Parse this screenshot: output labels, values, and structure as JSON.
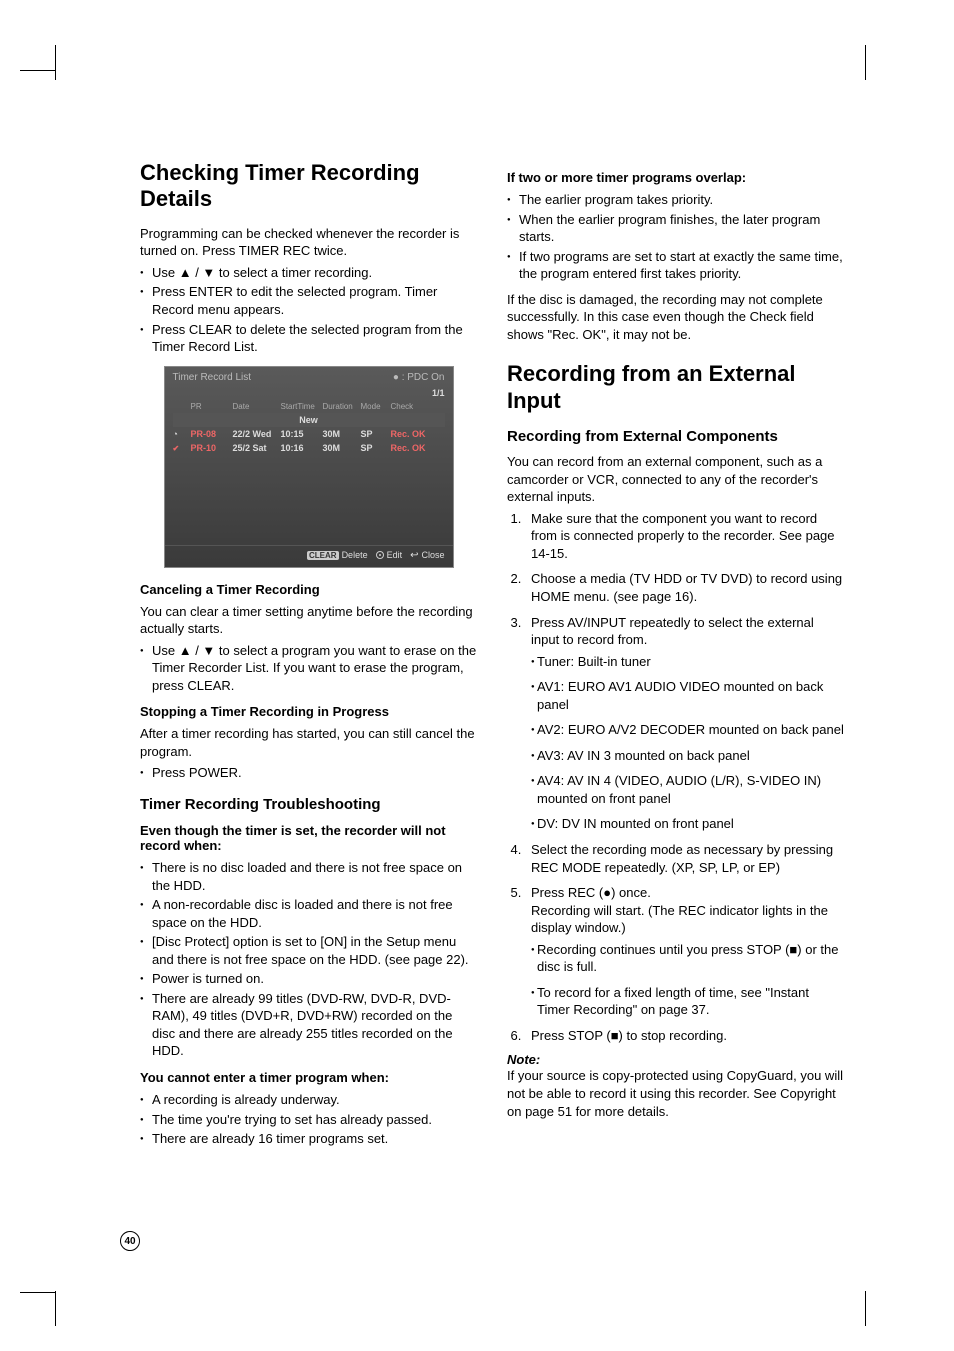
{
  "page_number": "40",
  "left": {
    "h1": "Checking Timer Recording Details",
    "intro": "Programming can be checked whenever the recorder is turned on. Press TIMER REC twice.",
    "intro_list": [
      "Use ▲ / ▼ to select a timer recording.",
      "Press ENTER to edit the selected program. Timer Record menu appears.",
      "Press CLEAR to delete the selected program from the Timer Record List."
    ],
    "h3_cancel": "Canceling a Timer Recording",
    "cancel_p": "You can clear a timer setting anytime before the recording actually starts.",
    "cancel_list": [
      "Use ▲ / ▼ to select a program you want to erase on the Timer Recorder List. If you want to erase the program, press CLEAR."
    ],
    "h3_stop": "Stopping a Timer Recording in Progress",
    "stop_p": "After a timer recording has started, you can still cancel the program.",
    "stop_list": [
      "Press POWER."
    ],
    "h2_trouble": "Timer Recording Troubleshooting",
    "trouble_sub1": "Even though the timer is set, the recorder will not record when:",
    "trouble_list1": [
      "There is no disc loaded and there is not free space on the HDD.",
      "A non-recordable disc is loaded and there is not free space on the HDD.",
      "[Disc Protect] option is set to [ON] in the Setup menu and there is not free space on the HDD. (see page 22).",
      "Power is turned on.",
      "There are already 99 titles (DVD-RW, DVD-R, DVD-RAM), 49 titles (DVD+R, DVD+RW) recorded on the disc and there are already 255 titles recorded on the HDD."
    ],
    "trouble_sub2": "You cannot enter a timer program when:",
    "trouble_list2": [
      "A recording is already underway.",
      "The time you're trying to set has already passed.",
      "There are already 16 timer programs set."
    ]
  },
  "right": {
    "overlap_h3": "If two or more timer programs overlap:",
    "overlap_list": [
      "The earlier program takes priority.",
      "When the earlier program finishes, the later program starts.",
      "If two programs are set to start at exactly the same time, the program entered first takes priority."
    ],
    "damaged_p": "If the disc is damaged, the recording may not complete successfully. In this case even though the Check field shows \"Rec. OK\", it may not be.",
    "h1": "Recording from an External Input",
    "h2": "Recording from External Components",
    "intro_p": "You can record from an external component, such as a camcorder or VCR, connected to any of the recorder's external inputs.",
    "ol": [
      {
        "text": "Make sure that the component you want to record from is connected properly to the recorder. See page 14-15."
      },
      {
        "text": "Choose a media (TV HDD or TV DVD) to record using HOME menu. (see page 16)."
      },
      {
        "text": "Press AV/INPUT repeatedly to select the external input to record from.",
        "sub": [
          "Tuner: Built-in tuner",
          "AV1: EURO AV1 AUDIO VIDEO mounted on back panel",
          "AV2: EURO A/V2 DECODER mounted on back panel",
          "AV3: AV IN 3 mounted on back panel",
          "AV4: AV IN 4 (VIDEO, AUDIO (L/R), S-VIDEO IN) mounted on front panel",
          "DV: DV IN mounted on front panel"
        ]
      },
      {
        "text": "Select the recording mode as necessary by pressing REC MODE repeatedly. (XP, SP, LP, or EP)"
      },
      {
        "text": "Press REC (●) once.\nRecording will start. (The REC indicator lights in the display window.)",
        "sub": [
          "Recording continues until you press STOP (■) or the disc is full.",
          "To record for a fixed length of time, see \"Instant Timer Recording\" on page 37."
        ]
      },
      {
        "text": "Press STOP (■) to stop recording."
      }
    ],
    "note_label": "Note:",
    "note_p": "If your source is copy-protected using CopyGuard, you will not be able to record it using this recorder. See Copyright on page 51 for more details."
  },
  "screenshot": {
    "title": "Timer Record List",
    "pdc": "● : PDC On",
    "page": "1/1",
    "cols": {
      "pr": "PR",
      "date": "Date",
      "start": "StartTime",
      "dur": "Duration",
      "mode": "Mode",
      "check": "Check"
    },
    "new": "New",
    "rows": [
      {
        "icon": "clock",
        "pr": "PR-08",
        "date": "22/2 Wed",
        "start": "10:15",
        "dur": "30M",
        "mode": "SP",
        "check": "Rec. OK"
      },
      {
        "icon": "check",
        "pr": "PR-10",
        "date": "25/2 Sat",
        "start": "10:16",
        "dur": "30M",
        "mode": "SP",
        "check": "Rec. OK"
      }
    ],
    "footer": {
      "clear": "CLEAR",
      "delete": "Delete",
      "edit": "Edit",
      "close": "Close"
    }
  }
}
